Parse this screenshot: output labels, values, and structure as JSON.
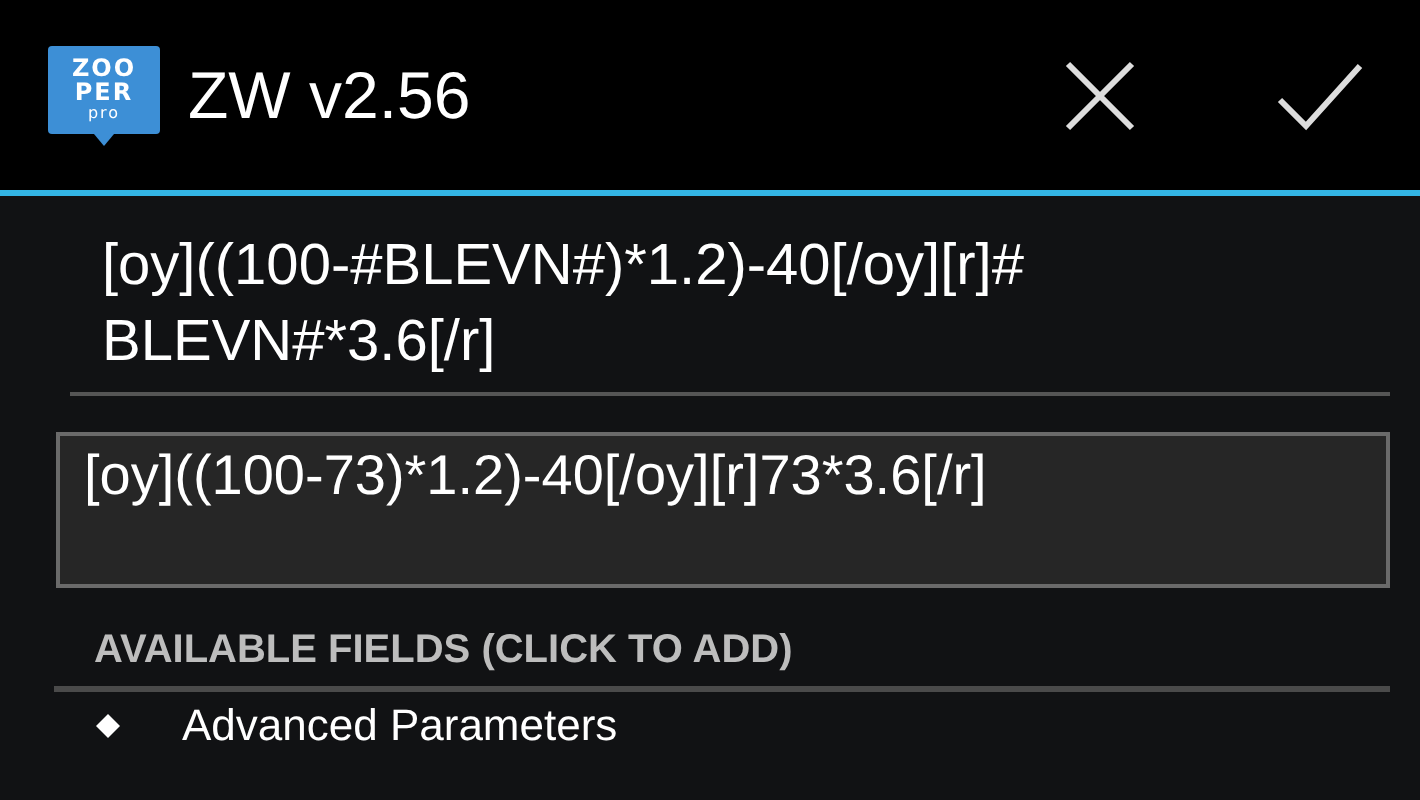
{
  "action_bar": {
    "logo": [
      "ZOO",
      "PER",
      "pro"
    ],
    "title": "ZW v2.56"
  },
  "formula_field": {
    "value": "[oy]((100-#BLEVN#)*1.2)-40[/oy][r]#BLEVN#*3.6[/r]"
  },
  "preview": {
    "text": "[oy]((100-73)*1.2)-40[/oy][r]73*3.6[/r]"
  },
  "section_header": "AVAILABLE FIELDS (CLICK TO ADD)",
  "fields": [
    {
      "label": "Advanced Parameters",
      "expanded": false
    }
  ]
}
